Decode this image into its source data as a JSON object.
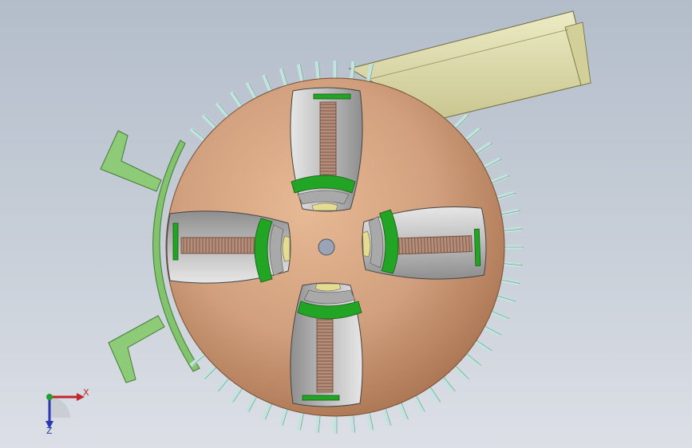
{
  "viewport": {
    "background_top": "#b3bdca",
    "background_bottom": "#dcdfe6"
  },
  "model": {
    "colors": {
      "sphere": "#d1a07e",
      "sphere_shadow": "#a8724f",
      "fins": "#c3e4dd",
      "fin_edge": "#6c8f89",
      "duct": "#dcd9a7",
      "duct_edge": "#6d6a3c",
      "bracket": "#8ecb78",
      "bracket_edge": "#3f7c34",
      "slot": "#c7c7c7",
      "slot_dark": "#8d8d8d",
      "green_ring": "#22a524",
      "spring": "#b58e7b",
      "spring_line": "#6a4433",
      "hub": "#9aa4b6"
    },
    "slot_count": 4,
    "fin_count": 64
  },
  "triad": {
    "x_label": "X",
    "z_label": "Z",
    "x_color": "#c0262c",
    "y_color": "#2a9a33",
    "z_color": "#2a39b0"
  }
}
